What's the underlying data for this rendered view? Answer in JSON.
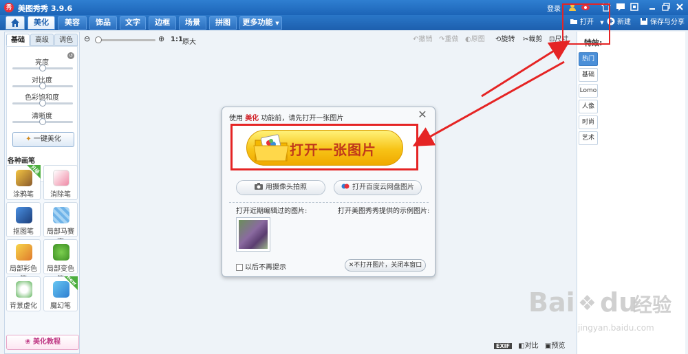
{
  "app": {
    "title": "美图秀秀 3.9.6",
    "logo_text": "秀",
    "login": "登录"
  },
  "menu": {
    "home_icon": "home-icon",
    "tabs": [
      {
        "label": "美化",
        "active": true
      },
      {
        "label": "美容",
        "active": false
      },
      {
        "label": "饰品",
        "active": false
      },
      {
        "label": "文字",
        "active": false
      },
      {
        "label": "边框",
        "active": false
      },
      {
        "label": "场景",
        "active": false
      },
      {
        "label": "拼图",
        "active": false
      },
      {
        "label": "更多功能",
        "active": false
      }
    ]
  },
  "toolbar": {
    "open_label": "打开",
    "new_label": "新建",
    "save_label": "保存与分享"
  },
  "left": {
    "subtabs": [
      "基础",
      "高级",
      "调色"
    ],
    "adjustments": [
      "亮度",
      "对比度",
      "色彩饱和度",
      "清晰度"
    ],
    "onekey_label": "一键美化",
    "section_title": "各种画笔",
    "brushes": [
      {
        "label": "涂鸦笔",
        "badge": "升级"
      },
      {
        "label": "消除笔",
        "badge": ""
      },
      {
        "label": "抠图笔",
        "badge": ""
      },
      {
        "label": "局部马赛克",
        "badge": ""
      },
      {
        "label": "局部彩色笔",
        "badge": ""
      },
      {
        "label": "局部变色笔",
        "badge": ""
      },
      {
        "label": "背景虚化",
        "badge": ""
      },
      {
        "label": "魔幻笔",
        "badge": "new"
      }
    ],
    "tutorial_label": "美化教程"
  },
  "canvas": {
    "zoom_ratio": "1:1",
    "zoom_original": "原大",
    "tools": [
      "撤销",
      "重做",
      "原图",
      "旋转",
      "裁剪",
      "尺寸"
    ]
  },
  "effects": {
    "title": "特效:",
    "tabs": [
      {
        "label": "热门",
        "active": true
      },
      {
        "label": "基础",
        "active": false
      },
      {
        "label": "Lomo",
        "active": false
      },
      {
        "label": "人像",
        "active": false
      },
      {
        "label": "时尚",
        "active": false
      },
      {
        "label": "艺术",
        "active": false
      }
    ]
  },
  "status": {
    "exif": "EXIF",
    "compare": "对比",
    "preview": "预览"
  },
  "dialog": {
    "hint_prefix": "使用",
    "hint_highlight": "美化",
    "hint_suffix": "功能前，请先打开一张图片",
    "open_big_label": "打开一张图片",
    "camera_label": "用摄像头拍照",
    "cloud_label": "打开百度云网盘图片",
    "recent_label": "打开近期编辑过的图片:",
    "sample_label": "打开美图秀秀提供的示例图片:",
    "dont_show_label": "以后不再提示",
    "close_label": "不打开图片，关闭本窗口"
  },
  "watermark": {
    "brand": "Bai",
    "brand2": "du",
    "chinese": "经验",
    "url": "jingyan.baidu.com"
  },
  "colors": {
    "title_blue": "#1c64b7",
    "highlight_red": "#e52424",
    "open_yellow": "#f7c316"
  }
}
